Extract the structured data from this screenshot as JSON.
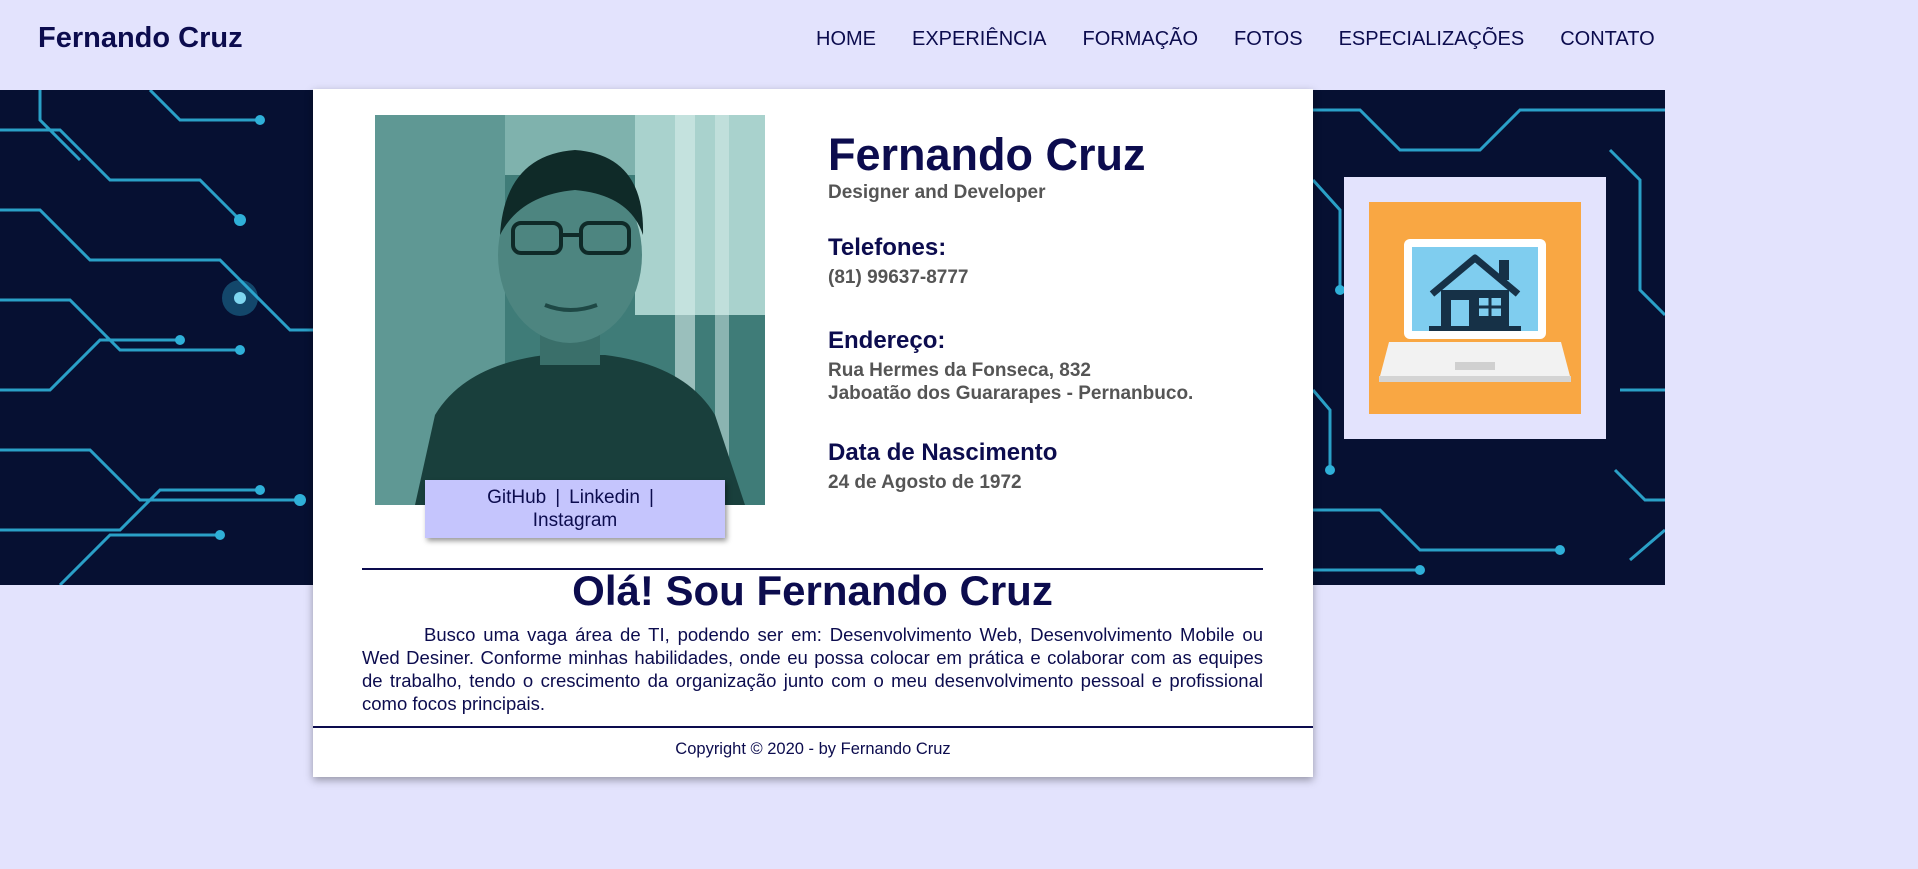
{
  "header": {
    "brand": "Fernando Cruz",
    "nav": [
      "HOME",
      "EXPERIÊNCIA",
      "FORMAÇÃO",
      "FOTOS",
      "ESPECIALIZAÇÕES",
      "CONTATO"
    ]
  },
  "profile": {
    "name": "Fernando Cruz",
    "role": "Designer and Developer",
    "phone_heading": "Telefones:",
    "phone": "(81) 99637-8777",
    "address_heading": "Endereço:",
    "address_line1": "Rua Hermes da Fonseca, 832",
    "address_line2": "Jaboatão dos Guararapes - Pernanbuco.",
    "birth_heading": "Data de Nascimento",
    "birth": "24 de Agosto de 1972"
  },
  "social": {
    "github": "GitHub",
    "linkedin": "Linkedin",
    "instagram": "Instagram",
    "separator": "|"
  },
  "about": {
    "heading": "Olá! Sou Fernando Cruz",
    "text": "Busco uma vaga área de TI, podendo ser em: Desenvolvimento Web, Desenvolvimento Mobile ou Wed Desiner. Conforme minhas habilidades, onde eu possa colocar em prática e colaborar com as equipes de trabalho, tendo o crescimento da organização junto com o meu desenvolvimento pessoal e profissional como focos principais."
  },
  "footer": {
    "copyright": "Copyright © 2020 - by Fernando Cruz"
  },
  "icons": {
    "profile_photo": "person-portrait-photo",
    "laptop": "laptop-home-icon",
    "banner": "circuit-board-background"
  },
  "colors": {
    "page_bg": "#e3e3fd",
    "text_primary": "#0c0c4e",
    "text_secondary": "#555555",
    "social_bg": "#c5c5fd",
    "banner_bg": "#061032",
    "circuit": "#2fb0d8",
    "laptop_bg": "#f9a743"
  }
}
